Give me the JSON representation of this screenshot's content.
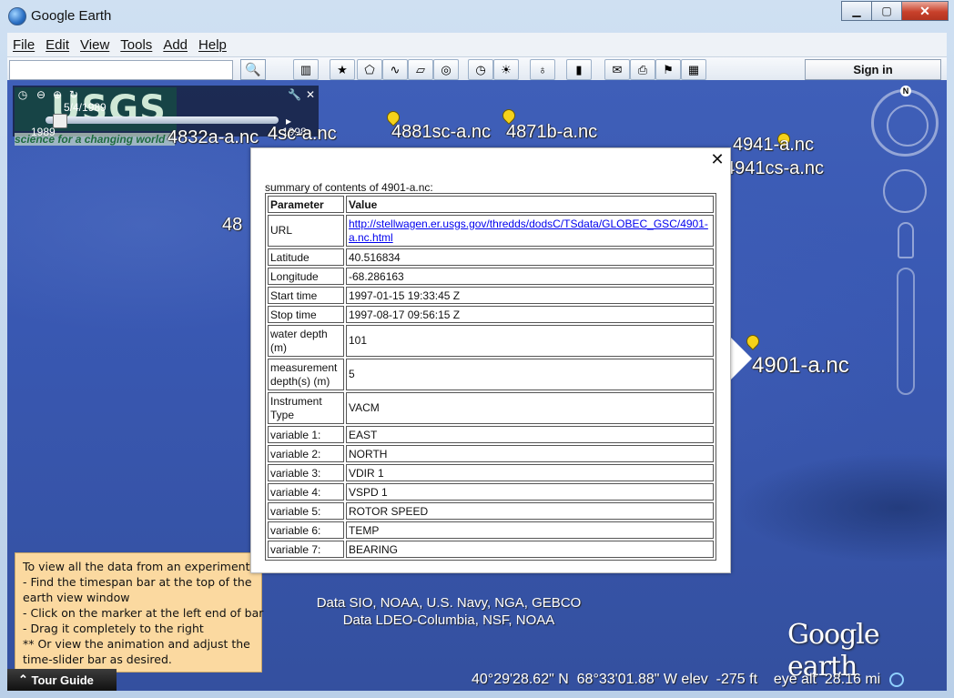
{
  "window": {
    "title": "Google Earth",
    "minimize": "▁",
    "maximize": "▢",
    "close": "✕"
  },
  "menu": [
    "File",
    "Edit",
    "View",
    "Tools",
    "Add",
    "Help"
  ],
  "toolbar": {
    "search_placeholder": "",
    "sign_in": "Sign in"
  },
  "timeslider": {
    "date": "5/4/1989",
    "start": "1989",
    "end": "1998"
  },
  "placemarks": [
    {
      "label": "4832a-a.nc"
    },
    {
      "label": "4sc-a.nc"
    },
    {
      "label": "4881sc-a.nc"
    },
    {
      "label": "4871b-a.nc"
    },
    {
      "label": "4941-a.nc"
    },
    {
      "label": "4941cs-a.nc"
    },
    {
      "label": "48"
    },
    {
      "label": "4901-a.nc"
    }
  ],
  "balloon": {
    "summary": "summary of contents of 4901-a.nc:",
    "headers": [
      "Parameter",
      "Value"
    ],
    "url_label": "URL",
    "url_value": "http://stellwagen.er.usgs.gov/thredds/dodsC/TSdata/GLOBEC_GSC/4901-a.nc.html",
    "rows": [
      {
        "param": "Latitude",
        "value": "40.516834"
      },
      {
        "param": "Longitude",
        "value": "-68.286163"
      },
      {
        "param": "Start time",
        "value": "1997-01-15 19:33:45 Z"
      },
      {
        "param": "Stop time",
        "value": "1997-08-17 09:56:15 Z"
      },
      {
        "param": "water depth (m)",
        "value": "101"
      },
      {
        "param": "measurement depth(s) (m)",
        "value": "5"
      },
      {
        "param": "Instrument Type",
        "value": "VACM"
      },
      {
        "param": "variable 1:",
        "value": "EAST"
      },
      {
        "param": "variable 2:",
        "value": "NORTH"
      },
      {
        "param": "variable 3:",
        "value": "VDIR 1"
      },
      {
        "param": "variable 4:",
        "value": "VSPD 1"
      },
      {
        "param": "variable 5:",
        "value": "ROTOR SPEED"
      },
      {
        "param": "variable 6:",
        "value": "TEMP"
      },
      {
        "param": "variable 7:",
        "value": "BEARING"
      }
    ]
  },
  "logo": {
    "usgs": "USGS",
    "tagline": "science for a changing world"
  },
  "help_note": [
    "To view all the data from an experiment:",
    " - Find the timespan bar at the top of the",
    "     earth view window",
    " - Click on the marker at the left end of bar",
    " - Drag it completely to the right",
    " ** Or view the animation and adjust the",
    "     time-slider bar as desired."
  ],
  "attribution": {
    "line1": "Data SIO, NOAA, U.S. Navy, NGA, GEBCO",
    "line2": "Data LDEO-Columbia, NSF, NOAA"
  },
  "google_earth_logo": "Google earth",
  "tour_guide": "Tour Guide",
  "status": {
    "lat": "40°29'28.62\" N",
    "lon": "68°33'01.88\" W",
    "elev_label": "elev",
    "elev": "-275 ft",
    "eye_label": "eye alt",
    "eye": "28.16 mi"
  },
  "colors": {
    "ocean": "#3958b2",
    "pin": "#f5d21a",
    "note": "#fbd9a0"
  }
}
